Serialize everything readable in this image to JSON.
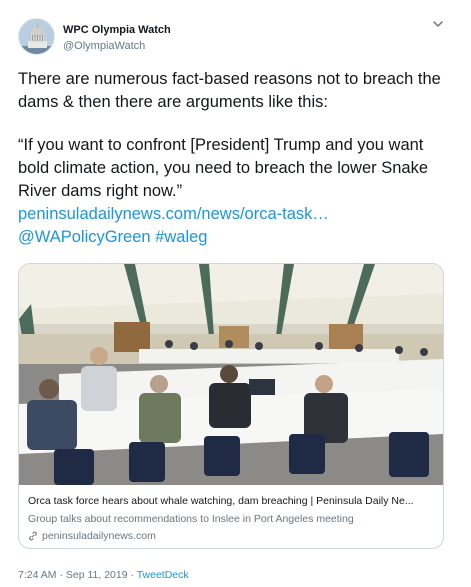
{
  "header": {
    "display_name": "WPC Olympia Watch",
    "handle": "@OlympiaWatch"
  },
  "tweet": {
    "paragraph_1": "There are numerous fact-based reasons not to breach the dams & then there are arguments like this:",
    "paragraph_2": "“If you want to confront [President] Trump and you want bold climate action, you need to breach the lower Snake River dams right now.”",
    "link_url": "peninsuladailynews.com/news/orca-task…",
    "mention": "@WAPolicyGreen",
    "hashtag": "#waleg"
  },
  "card": {
    "title": "Orca task force hears about whale watching, dam breaching | Peninsula Daily Ne...",
    "description": "Group talks about recommendations to Inslee in Port Angeles meeting",
    "domain": "peninsuladailynews.com"
  },
  "meta": {
    "time_date": "7:24 AM · Sep 11, 2019 · ",
    "source": "TweetDeck"
  },
  "icons": {
    "caret": "chevron-down-icon",
    "link": "link-icon",
    "avatar": "capitol-dome-avatar"
  },
  "colors": {
    "link": "#1b95e0",
    "secondary_text": "#657786",
    "border": "#ccd6dd"
  }
}
